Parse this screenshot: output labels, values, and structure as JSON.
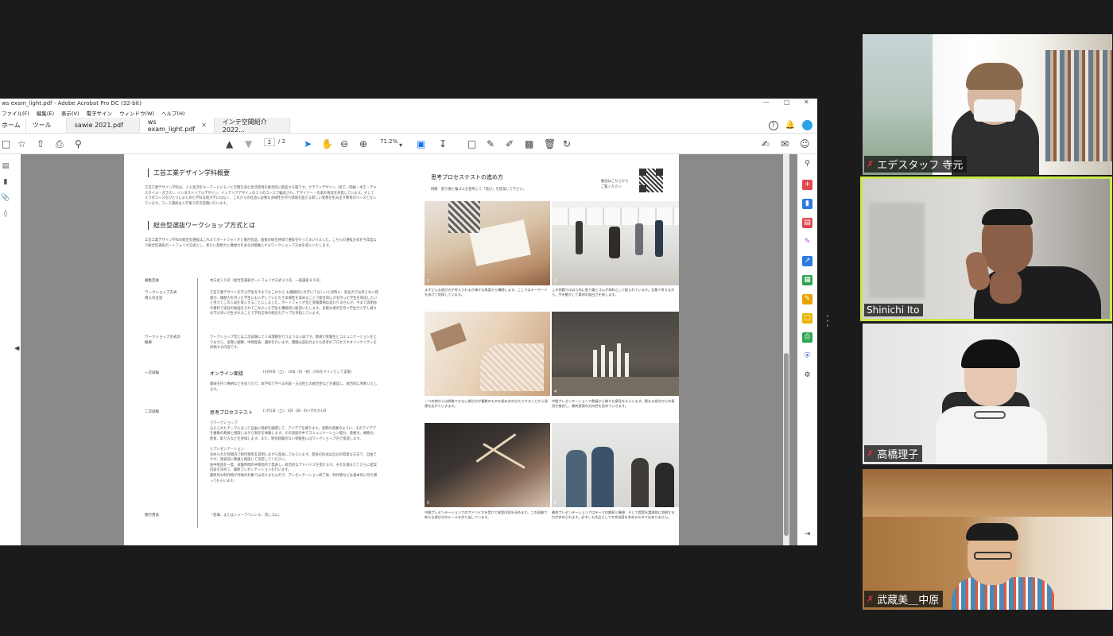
{
  "acrobat": {
    "title": "ws exam_light.pdf - Adobe Acrobat Pro DC (32-bit)",
    "menu": [
      "ファイル(F)",
      "編集(E)",
      "表示(V)",
      "電子サイン",
      "ウィンドウ(W)",
      "ヘルプ(H)"
    ],
    "tabs": [
      {
        "label": "ホーム"
      },
      {
        "label": "ツール"
      },
      {
        "label": "sawie 2021.pdf"
      },
      {
        "label": "ws exam_light.pdf",
        "active": true
      },
      {
        "label": "インテ空間紹介2022..."
      }
    ],
    "toolbar": {
      "page_current": "2",
      "page_total": "/ 2",
      "zoom": "71.2%"
    },
    "accent_color": "#1473e6"
  },
  "pdf": {
    "left": {
      "heading1": "工芸工業デザイン学科概要",
      "body1": "工芸工業デザイン学科は、人と生活をキーワードにモノと空間を含む生活環境を総合的に創造する場です。クラフトデザイン（金工・陶磁・木工・テキスタイル・ガラス）、インダストリアルデザイン、インテリアデザインの３つのコースで編成され、デザイナー・作家の育成を目指しています。そして３つのコースをひとつにまとめた学科は他大学にはなく、これからの社会に必要な多様性を持ち領域を超える新しい発想を生み出す教育のベースとなっています。コース選択は入学後２年次前期に行います。",
      "heading2": "総合型選抜ワークショップ方式とは",
      "body2": "工芸工業デザイン学科の総合型選抜はこれまでポートフォリオと競合作品、面接の総合評価で選抜を行ってまいりました。こちらの選抜方式を今年度より総合型選抜ポートフォリオ方式とし、新たに発想力と構想力を主な評価軸とするワークショップ方式を導入いたします。",
      "rows": [
        {
          "label": "募集定員",
          "text": "本方式１０名（総合型選抜ポートフォリオ方式２０名、一般選抜９０名）"
        },
        {
          "label": "ワークショップ方式\n導入の主旨",
          "text": "工芸工業デザインを学ぶ学生を今までもこれから も積極的に大学にてほしいと同時に、実技力では見えない発想力、構想力を持った学生にも入学していただき多様性を高めることで総合的に力を持った学生を育成したいと考えてこの入試を導入することにしました。ポートフォリオ型と受験資格は変わりませんが、今まで説明会や資料で実技の勉強をされてこなかった学生も積極的に歓迎いたします。多様な視点を持つ学生が入学し様々な学びあいが生まれることで学科全体の総合力アップを目指しています。"
        },
        {
          "label": "ワークショップ方式の\n概要",
          "text": "ワークショップ型とは二次試験にて１日課題を行うような入試です。教員が受験生とコミュニケーションをとりながら、実際に観察、中間発表、講評を行います。課題は造形力よりも思考のプロセスやオリジナリティを評価する内容です。"
        },
        {
          "label": "一次試験",
          "title": "オンライン面接",
          "date": "10月9日（土）、10日（日・祝）（9日をメインとして実施）",
          "text": "興味を持つ事柄などを伺うかで、本学科で学べる内容・方向性との総合性などを確認し、総合的に判断いたします。"
        },
        {
          "label": "二次試験",
          "title": "思考プロセステスト",
          "date": "11月5日（土）、6日（日）のいずれか1日",
          "text": "①ワークショップ\n与えられたテーマに沿って自由に発想を展開して、アイデアを練ります。実際の授業のように、そのアイデアを複数の教員と相談しながら制作を体験します。その過程の中でコミュニケーション能力、発想力、構想力、熱意、取り方などを評価します。また、制作経験のない受験生にはワークショップ内で指導します。\n\n②プレゼンテーション\n決められた時間内で制作物等を説明しながら発表してもらいます。発表の形式は自分の得意な方法で、自由ですが、発表前に教員と相談して決定してください。\n途中経過を一度、試験時間の中間地点で発表し、総合的なアドバイスを受けます。それを踏まえてさらに提案内容を深めて、最終プレゼンテーションを行います。\n最終的な制作物が評価の対象ではありませんので、プレゼンテーション終了後、制作物などは基本的に持ち帰ってもらいます。"
        },
        {
          "label": "携行用具",
          "text": "「鉛筆、またはシャープペンシル、消しゴム」"
        }
      ]
    },
    "right": {
      "heading": "思考プロセステストの進め方",
      "example": "例題　割り箸と輪ゴムを使用して「遊び」を提案して下さい。",
      "qr_note": "動画はこちらから\nご覧ください",
      "captions": [
        "まずどんな遊び方が考えられるか様々な角度から構想します。ここではキーワードをあげて見探しています。",
        "この例題では自ら的に割り箸とゴムが材料として配られています。言葉で考えながら、手を動かして素材の面白さを探します。",
        "一つの物からは想像できない遊び方が複数のものを組み合わせたりすることから発想を広げていきます。",
        "中間プレゼンテーションで教員から様々な意見をもらいます。異なる視点からの意見を検討し、最終提案の方向性を定めていきます。",
        "中間プレゼンテーションでのアドバイスを受けて修案内容を深めます。この段階で新たな遊び方のルールを作り出しています。",
        "最終プレゼンテーションではテーマの解釈と構想、そして提案を論理的に説明する力が求められます。必ずしも作品としての完成度を求めるものではありません。"
      ],
      "photo_numbers": [
        "1",
        "2",
        "3",
        "4",
        "5",
        "6"
      ]
    }
  },
  "participants": [
    {
      "name": "エデスタッフ 寺元",
      "muted": true
    },
    {
      "name": "Shinichi Ito",
      "muted": false,
      "active_speaker": true
    },
    {
      "name": "高橋理子",
      "muted": true
    },
    {
      "name": "武蔵美＿中原",
      "muted": true
    }
  ],
  "speaker_highlight_color": "#c8e84a",
  "mute_color": "#e0303b"
}
